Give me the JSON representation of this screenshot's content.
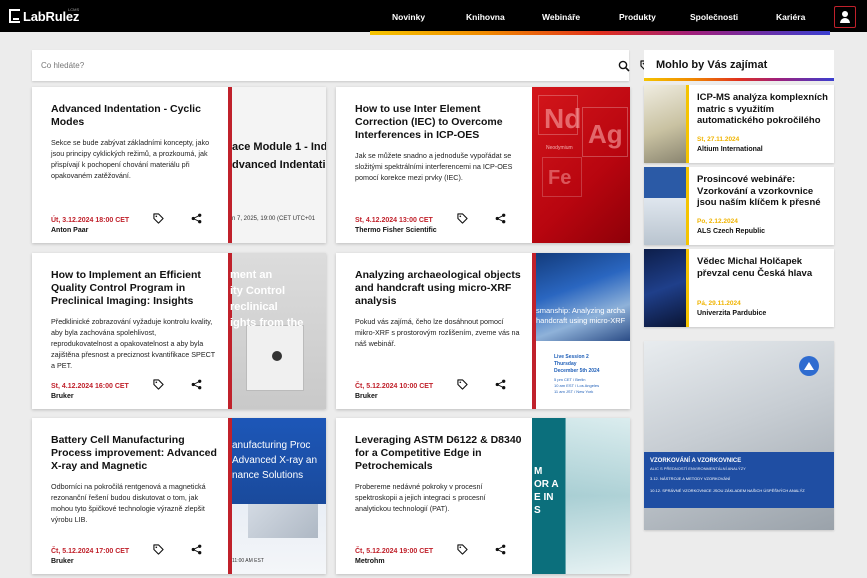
{
  "header": {
    "logo_text": "LabRulez",
    "logo_tag": "LCMS",
    "nav": [
      "Novinky",
      "Knihovna",
      "Webináře",
      "Produkty",
      "Společnosti",
      "Kariéra"
    ]
  },
  "search": {
    "placeholder": "Co hledáte?"
  },
  "cards": [
    {
      "title": "Advanced Indentation - Cyclic Modes",
      "desc": "Sekce se bude zabývat základními koncepty, jako jsou principy cyklických režimů, a prozkoumá, jak přispívají k pochopení chování materiálu při opakovaném zatěžování.",
      "date": "Út, 3.12.2024 18:00 CET",
      "org": "Anton Paar",
      "img_lines": [
        "ace Module 1 - Ind",
        "dvanced Indentati",
        "n 7, 2025, 19:00 (CET UTC+01"
      ]
    },
    {
      "title": "How to use Inter Element Correction (IEC) to Overcome Interferences in ICP-OES",
      "desc": "Jak se můžete snadno a jednoduše vypořádat se složitými spektrálními interferencemi na ICP-OES pomocí korekce mezi prvky (IEC).",
      "date": "St, 4.12.2024 13:00 CET",
      "org": "Thermo Fisher Scientific",
      "img_lines": [
        "Nd",
        "Ag",
        "Fe",
        "Neodymium"
      ]
    },
    {
      "title": "How to Implement an Efficient Quality Control Program in Preclinical Imaging: Insights",
      "desc": "Předklinické zobrazování vyžaduje kontrolu kvality, aby byla zachována spolehlivost, reprodukovatelnost a opakovatelnost a aby byla zajištěna přesnost a preciznost kvantifikace SPECT a PET.",
      "date": "St, 4.12.2024 16:00 CET",
      "org": "Bruker",
      "img_lines": [
        "ment an",
        "ity Control",
        "reclinical",
        "ights from the"
      ]
    },
    {
      "title": "Analyzing archaeological objects and handcraft using micro-XRF analysis",
      "desc": "Pokud vás zajímá, čeho lze dosáhnout pomocí mikro-XRF s prostorovým rozlišením, zveme vás na náš webinář.",
      "date": "Čt, 5.12.2024 10:00 CET",
      "org": "Bruker",
      "img_lines": [
        "smanship: Analyzing archa",
        "handcraft using micro-XRF",
        "Live Session 2",
        "Thursday",
        "December 5th 2024",
        "5 pm CET / Berlin",
        "10 am EST / Los Angeles",
        "11 am JST / New York"
      ]
    },
    {
      "title": "Battery Cell Manufacturing Process improvement: Advanced X-ray and Magnetic",
      "desc": "Odborníci na pokročilá rentgenová a magnetická rezonanční řešení budou diskutovat o tom, jak mohou tyto špičkové technologie výrazně zlepšit výrobu LIB.",
      "date": "Čt, 5.12.2024 17:00 CET",
      "org": "Bruker",
      "img_lines": [
        "anufacturing Proc",
        "Advanced X-ray an",
        "nance Solutions",
        "11:00 AM EST"
      ]
    },
    {
      "title": "Leveraging ASTM D6122 & D8340 for a Competitive Edge in Petrochemicals",
      "desc": "Probereme nedávné pokroky v procesní spektroskopii a jejich integraci s procesní analytickou technologií (PAT).",
      "date": "Čt, 5.12.2024 19:00 CET",
      "org": "Metrohm",
      "img_lines": [
        "M",
        "OR A",
        "E IN",
        "S"
      ]
    }
  ],
  "sidebar": {
    "title": "Mohlo by Vás zajímat",
    "items": [
      {
        "title": "ICP-MS analýza komplexních matric s využitím automatického pokročilého",
        "date": "St, 27.11.2024",
        "org": "Altium International"
      },
      {
        "title": "Prosincové webináře: Vzorkování a vzorkovnice jsou naším klíčem k přesné",
        "date": "Po, 2.12.2024",
        "org": "ALS Czech Republic"
      },
      {
        "title": "Vědec Michal Holčapek převzal cenu Česká hlava",
        "date": "Pá, 29.11.2024",
        "org": "Univerzita Pardubice"
      }
    ],
    "ad": {
      "title": "VZORKOVÁNÍ A VZORKOVNICE",
      "subtitle": "ALIC S PŘEDNOSTÍ ENVIRONMENTÁLNÍ ANALÝZY",
      "lines": [
        "3.12.  NÁSTROJE A METODY VZORKOVÁNÍ",
        "10.12.  SPRÁVNÉ VZORKOVNICE JSOU ZÁKLADEM NAŠICH ÚSPĚŠNÝCH ANALÝZ"
      ]
    }
  },
  "colors": {
    "accent_red": "#c0212b",
    "accent_yellow": "#f5c400",
    "header_bg": "#000000"
  }
}
